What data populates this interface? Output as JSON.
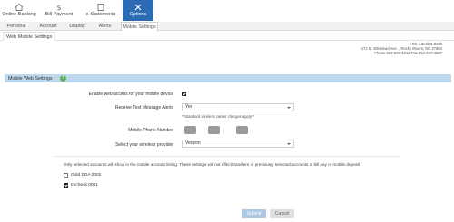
{
  "top_nav": [
    {
      "label": "Online Banking",
      "icon": "home-icon"
    },
    {
      "label": "Bill Payment",
      "icon": "dollar-icon"
    },
    {
      "label": "e-Statements",
      "icon": "statement-icon"
    },
    {
      "label": "Options",
      "icon": "tools-icon",
      "active": true
    }
  ],
  "sub_nav": [
    "Personal",
    "Account",
    "Display",
    "Alerts",
    "Mobile Settings"
  ],
  "page_tab": "Web Mobile Settings",
  "bank": {
    "name": "First Carolina Bank",
    "address": "171 N. Winstead Ave. , Rocky Mount, NC 27804",
    "phone": "Phone 252-937-4212 Fax 252-937-4567"
  },
  "panel": {
    "title": "Mobile Web Settings",
    "help": "?"
  },
  "form": {
    "enable_label": "Enable web access for your mobile device",
    "enable_checked": true,
    "text_alerts_label": "Receive Text Message Alerts",
    "text_alerts_value": "Yes",
    "text_alerts_note": "**Standard wireless carrier charges apply**",
    "phone_label": "Mobile Phone Number",
    "provider_label": "Select your wireless provider",
    "provider_value": "Verizon"
  },
  "accounts_note": "Only selected accounts will show in the mobile account listing. These settings will not effect transfers or previously selected accounts in bill pay or mobile deposit.",
  "accounts": [
    {
      "name": "Gold DDA 0002",
      "checked": false
    },
    {
      "name": "Imcheck 0001",
      "checked": true
    }
  ],
  "buttons": {
    "submit": "Submit",
    "cancel": "Cancel"
  },
  "colors": {
    "nav_active": "#2d6cb5",
    "panel_header": "#bed9ee",
    "help_badge": "#5db05f"
  }
}
